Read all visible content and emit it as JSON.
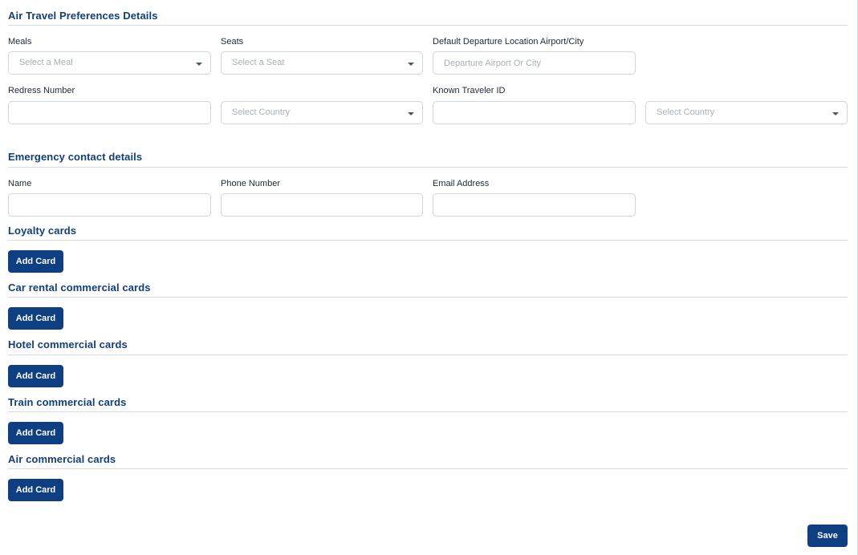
{
  "air_travel": {
    "title": "Air Travel Preferences Details",
    "meals": {
      "label": "Meals",
      "placeholder": "Select a Meal"
    },
    "seats": {
      "label": "Seats",
      "placeholder": "Select a Seat"
    },
    "departure": {
      "label": "Default Departure Location Airport/City",
      "placeholder": "Departure Airport Or City"
    },
    "redress": {
      "label": "Redress Number",
      "value": "",
      "country_placeholder": "Select Country"
    },
    "known_traveler": {
      "label": "Known Traveler ID",
      "value": "",
      "country_placeholder": "Select Country"
    }
  },
  "emergency": {
    "title": "Emergency contact details",
    "name": {
      "label": "Name",
      "value": ""
    },
    "phone": {
      "label": "Phone Number",
      "value": ""
    },
    "email": {
      "label": "Email Address",
      "value": ""
    }
  },
  "card_sections": [
    {
      "title": "Loyalty cards",
      "button": "Add Card"
    },
    {
      "title": "Car rental commercial cards",
      "button": "Add Card"
    },
    {
      "title": "Hotel commercial cards",
      "button": "Add Card"
    },
    {
      "title": "Train commercial cards",
      "button": "Add Card"
    },
    {
      "title": "Air commercial cards",
      "button": "Add Card"
    }
  ],
  "footer": {
    "save_label": "Save"
  },
  "colors": {
    "primary": "#0e3f82",
    "heading": "#123f7a",
    "border": "#cfd5dc",
    "placeholder": "#a9b0b9"
  }
}
